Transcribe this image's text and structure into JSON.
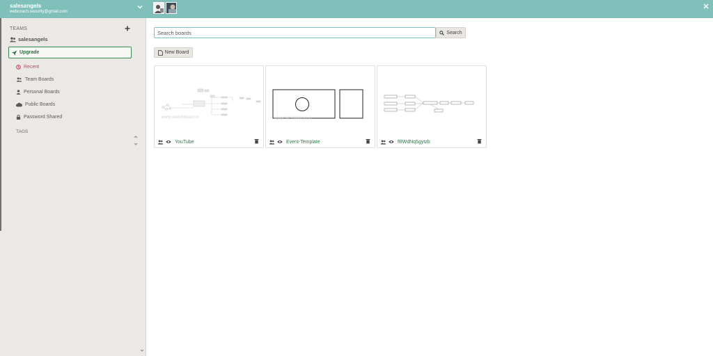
{
  "header": {
    "account_name": "salesangels",
    "account_email": "webcoach.security@gmail.com",
    "icons": [
      "chevron-down-icon",
      "close-icon"
    ]
  },
  "sidebar": {
    "teams_label": "TEAMS",
    "team_name": "salesangels",
    "upgrade_label": "Upgrade",
    "nav": {
      "recent": "Recent",
      "team_boards": "Team Boards",
      "personal_boards": "Personal Boards",
      "public_boards": "Public Boards",
      "password_shared": "Password Shared"
    },
    "tags_label": "TAGS"
  },
  "search": {
    "placeholder": "Search boards",
    "button_label": "Search"
  },
  "new_board_label": "New Board",
  "boards": [
    {
      "title": "YouTube",
      "watermark": "www.sketchboard.io"
    },
    {
      "title": "Event-Template",
      "watermark": "www.sketchboard.io"
    },
    {
      "title": "fBWdNq5gytzb"
    }
  ],
  "colors": {
    "header": "#7fc0bb",
    "sidebar": "#ebe9e6",
    "accent_green": "#2f7a4a",
    "recent_red": "#c2455b"
  }
}
